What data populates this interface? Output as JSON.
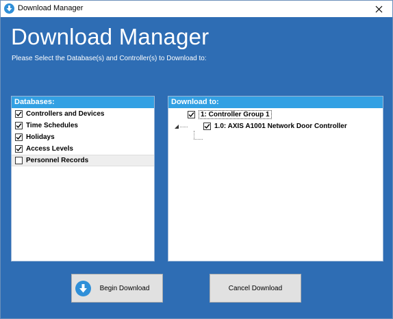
{
  "window": {
    "title": "Download Manager",
    "accent": "#2e6db4",
    "header_color": "#32a0e3"
  },
  "main": {
    "heading": "Download Manager",
    "subheading": "Please Select the Database(s) and Controller(s) to Download to:"
  },
  "databases": {
    "header": "Databases:",
    "items": [
      {
        "label": "Controllers and Devices",
        "checked": true
      },
      {
        "label": "Time Schedules",
        "checked": true
      },
      {
        "label": "Holidays",
        "checked": true
      },
      {
        "label": "Access Levels",
        "checked": true
      },
      {
        "label": "Personnel Records",
        "checked": false
      }
    ]
  },
  "download_to": {
    "header": "Download to:",
    "group": {
      "label": "1:  Controller Group 1",
      "checked": true,
      "expanded": true
    },
    "controller": {
      "label": "1.0:  AXIS A1001 Network Door Controller",
      "checked": true
    }
  },
  "buttons": {
    "begin": "Begin Download",
    "cancel": "Cancel Download"
  }
}
